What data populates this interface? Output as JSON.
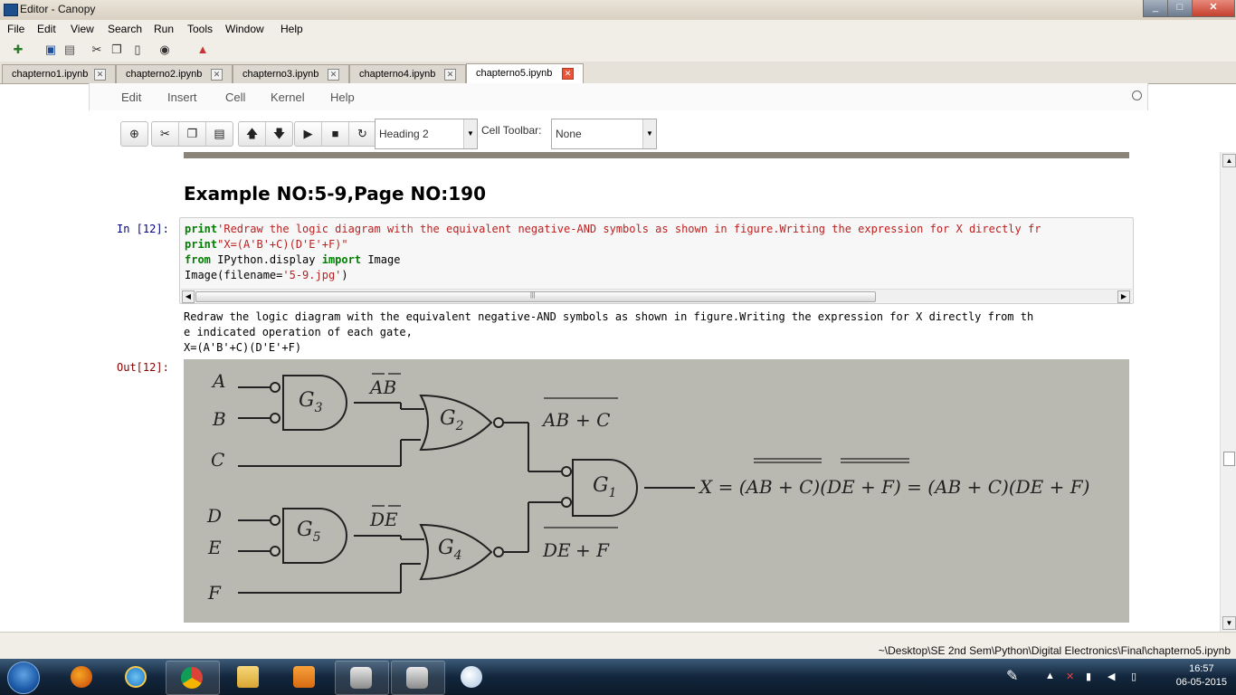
{
  "window": {
    "title": "Editor - Canopy",
    "close_glyph": "✕",
    "min_glyph": "_",
    "max_glyph": "□"
  },
  "menubar": [
    "File",
    "Edit",
    "View",
    "Search",
    "Run",
    "Tools",
    "Window",
    "Help"
  ],
  "toolbar_icons": [
    "new-file-icon",
    "save-icon",
    "save-all-icon",
    "cut-icon",
    "copy-icon",
    "paste-icon",
    "find-icon",
    "run-debug-icon"
  ],
  "tabs": [
    {
      "label": "chapterno1.ipynb",
      "active": false
    },
    {
      "label": "chapterno2.ipynb",
      "active": false
    },
    {
      "label": "chapterno3.ipynb",
      "active": false
    },
    {
      "label": "chapterno4.ipynb",
      "active": false
    },
    {
      "label": "chapterno5.ipynb",
      "active": true
    }
  ],
  "ipython_menu": [
    "Edit",
    "Insert",
    "Cell",
    "Kernel",
    "Help"
  ],
  "ipython_toolbar": {
    "cell_type": "Heading 2",
    "cell_toolbar_label": "Cell Toolbar:",
    "cell_toolbar_value": "None"
  },
  "notebook": {
    "heading": "Example NO:5-9,Page NO:190",
    "in_prompt": "In [12]:",
    "out_prompt": "Out[12]:",
    "code": {
      "line1_kw": "print",
      "line1_str": "'Redraw the logic diagram with the equivalent negative-AND symbols as shown in figure.Writing the expression for X directly fr",
      "line2_kw": "print",
      "line2_str": "\"X=(A'B'+C)(D'E'+F)\"",
      "line3_kw1": "from",
      "line3_mod": " IPython.display ",
      "line3_kw2": "import",
      "line3_name": " Image",
      "line4_pre": "Image(filename=",
      "line4_str": "'5-9.jpg'",
      "line4_post": ")"
    },
    "output_lines": [
      "Redraw the logic diagram with the equivalent negative-AND symbols as shown in figure.Writing the expression for X directly from th",
      "e indicated operation of each gate,",
      "X=(A'B'+C)(D'E'+F)"
    ],
    "figure": {
      "inputs": [
        "A",
        "B",
        "C",
        "D",
        "E",
        "F"
      ],
      "gates": [
        "G3",
        "G2",
        "G1",
        "G5",
        "G4"
      ],
      "sub_labels": {
        "G3": "3",
        "G2": "2",
        "G1": "1",
        "G5": "5",
        "G4": "4"
      },
      "g": "G",
      "ab_bar": "AB",
      "de_bar": "DE",
      "plus_c": "+ C",
      "plus_f": "+ F",
      "expression": "X = (AB + C)(DE + F) = (AB + C)(DE + F)"
    }
  },
  "statusbar": {
    "path": "~\\Desktop\\SE 2nd Sem\\Python\\Digital Electronics\\Final\\chapterno5.ipynb"
  },
  "taskbar": {
    "apps": [
      "firefox-icon",
      "internet-explorer-icon",
      "chrome-icon",
      "file-explorer-icon",
      "media-player-icon",
      "canopy-icon",
      "canopy-icon-2",
      "paint-icon"
    ],
    "time": "16:57",
    "date": "06-05-2015"
  }
}
